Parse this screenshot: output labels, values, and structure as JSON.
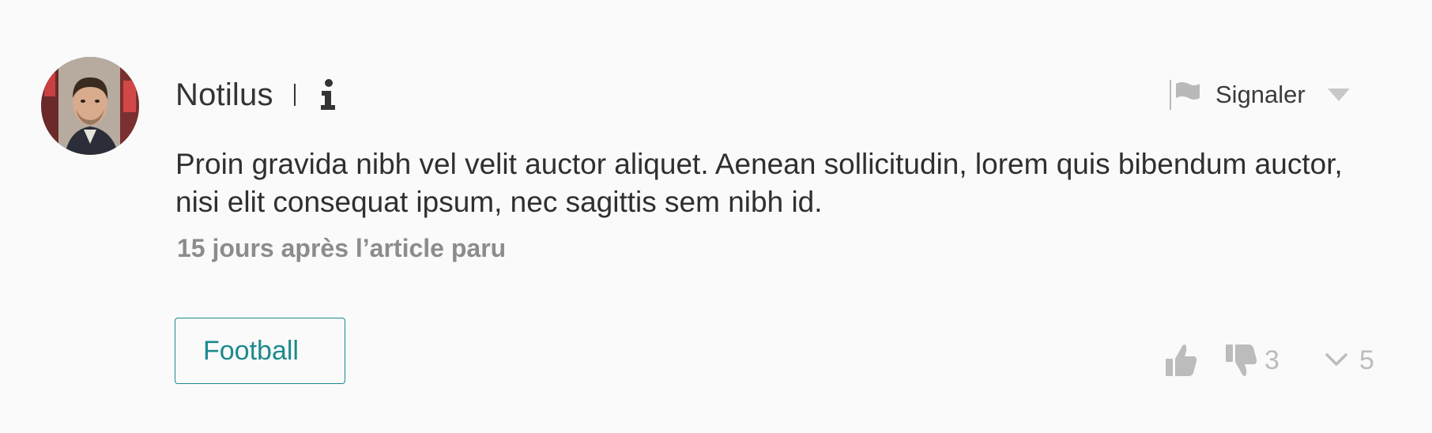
{
  "comment": {
    "author": "Notilus",
    "body": "Proin gravida nibh vel velit auctor aliquet. Aenean sollicitudin, lorem quis bibendum auctor, nisi elit consequat ipsum, nec sagittis sem nibh id.",
    "timestamp": "15 jours après l’article paru",
    "tag": "Football"
  },
  "report": {
    "label": "Signaler"
  },
  "reactions": {
    "dislike_count": "3",
    "replies_count": "5"
  },
  "icons": {
    "info": "info-icon",
    "flag": "flag-icon",
    "caret": "caret-down-icon",
    "like": "thumbs-up-icon",
    "dislike": "thumbs-down-icon",
    "expand": "chevron-down-icon"
  },
  "colors": {
    "background": "#fafafb",
    "text": "#333436",
    "muted": "#8c8c8c",
    "icon_muted": "#bcbcbc",
    "accent": "#1d8a8c"
  }
}
